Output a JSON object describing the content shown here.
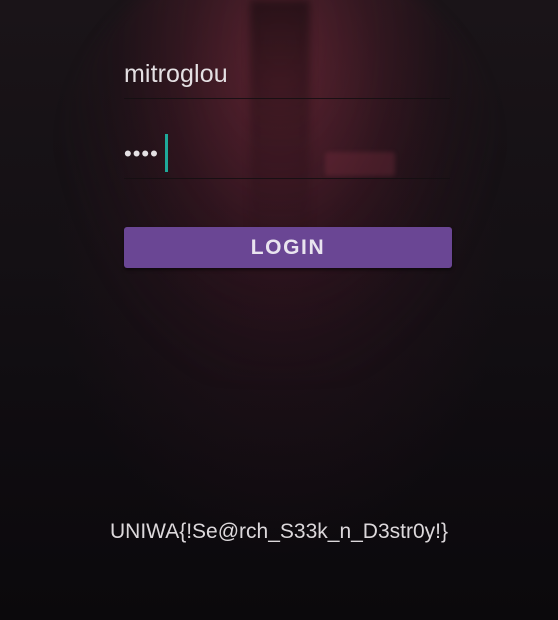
{
  "login": {
    "username_value": "mitroglou",
    "password_masked": "••••",
    "button_label": "LOGIN"
  },
  "footer": {
    "flag_text": "UNIWA{!Se@rch_S33k_n_D3str0y!}"
  },
  "colors": {
    "accent_button": "#6a4694",
    "cursor": "#1fa99a",
    "text": "#e4e0e3",
    "background": "#0e0b0e"
  }
}
